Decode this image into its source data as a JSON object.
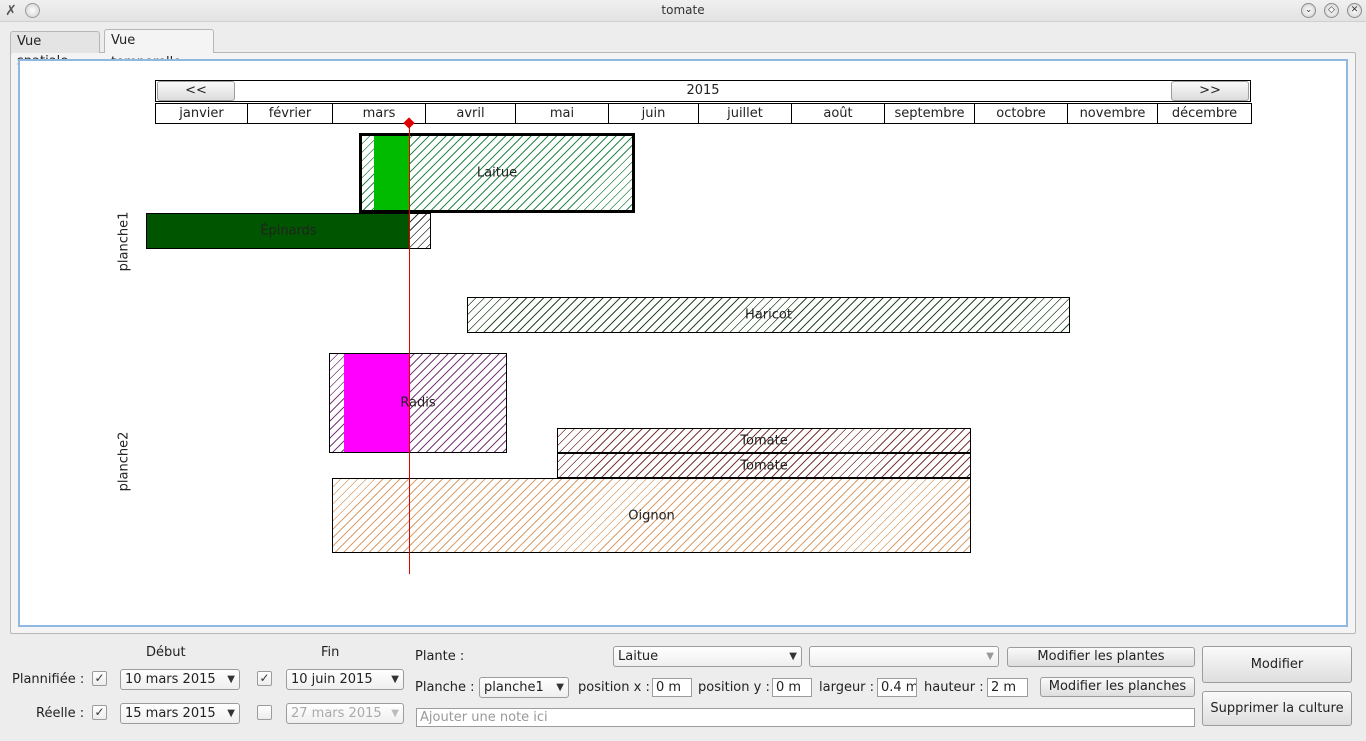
{
  "window": {
    "title": "tomate"
  },
  "tabs": [
    {
      "label": "Vue spatiale"
    },
    {
      "label": "Vue temporelle"
    }
  ],
  "timeline": {
    "year": "2015",
    "prev_label": "<<",
    "next_label": ">>",
    "months": [
      "janvier",
      "février",
      "mars",
      "avril",
      "mai",
      "juin",
      "juillet",
      "août",
      "septembre",
      "octobre",
      "novembre",
      "décembre"
    ],
    "today_month_position": 2.83,
    "planches": [
      {
        "label": "planche1"
      },
      {
        "label": "planche2"
      }
    ],
    "cultures": [
      {
        "name": "Laitue",
        "color": "#00bb00",
        "hatch": "#2a8a4a",
        "selected": true
      },
      {
        "name": "Épinards",
        "color": "#005500",
        "hatch": "#333333"
      },
      {
        "name": "Haricot",
        "color": "#005500",
        "hatch": "#2a4a2a"
      },
      {
        "name": "Radis",
        "color": "#ff00ff",
        "hatch": "#7a3a7a"
      },
      {
        "name": "Tomate",
        "color": "#aa2222",
        "hatch": "#7a3a3a"
      },
      {
        "name": "Tomate",
        "color": "#aa2222",
        "hatch": "#7a3a3a"
      },
      {
        "name": "Oignon",
        "color": "#e8a060",
        "hatch": "#d9a070"
      }
    ]
  },
  "form": {
    "debut_label": "Début",
    "fin_label": "Fin",
    "plannifiee_label": "Plannifiée :",
    "reelle_label": "Réelle :",
    "plannifiee_debut": "10 mars 2015",
    "plannifiee_fin": "10 juin 2015",
    "reelle_debut": "15 mars 2015",
    "reelle_fin": "27 mars 2015",
    "plante_label": "Plante :",
    "plante_value": "Laitue",
    "variete_value": "",
    "modifier_plantes": "Modifier les plantes",
    "planche_label": "Planche :",
    "planche_value": "planche1",
    "position_x_label": "position x :",
    "position_x": "0 m",
    "position_y_label": "position y :",
    "position_y": "0 m",
    "largeur_label": "largeur :",
    "largeur": "0.4 m",
    "hauteur_label": "hauteur :",
    "hauteur": "2 m",
    "modifier_planches": "Modifier les planches",
    "note_placeholder": "Ajouter une note ici",
    "modifier": "Modifier",
    "supprimer": "Supprimer la culture"
  }
}
